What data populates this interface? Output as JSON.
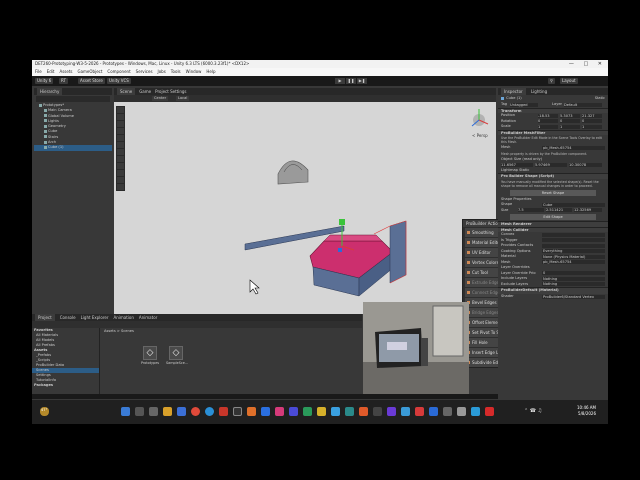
{
  "window": {
    "title": "DET260-Prototyping-W3-5-2026 - Prototypes - Windows, Mac, Linux - Unity 6.3 LTS (6000.3.23f1)* <DX12>"
  },
  "menu": [
    "File",
    "Edit",
    "Assets",
    "GameObject",
    "Component",
    "Services",
    "Jobs",
    "Tools",
    "Window",
    "Help"
  ],
  "toolbar": {
    "unity": "Unity 6",
    "account": "RT",
    "asset_store": "Asset Store",
    "vcs": "Unity VCS",
    "layout": "Layout"
  },
  "hierarchy": {
    "tab": "Hierarchy",
    "items": [
      {
        "label": "Prototypes*",
        "indent": 1,
        "selected": false
      },
      {
        "label": "Main Camera",
        "indent": 2,
        "selected": false
      },
      {
        "label": "Global Volume",
        "indent": 2,
        "selected": false
      },
      {
        "label": "Lights",
        "indent": 2,
        "selected": false
      },
      {
        "label": "Geometry",
        "indent": 2,
        "selected": false
      },
      {
        "label": "Cube",
        "indent": 2,
        "selected": false
      },
      {
        "label": "Stairs",
        "indent": 2,
        "selected": false
      },
      {
        "label": "Arch",
        "indent": 2,
        "selected": false
      },
      {
        "label": "Cube (1)",
        "indent": 2,
        "selected": true
      }
    ]
  },
  "scene_tabs": [
    "Scene",
    "Game",
    "Project Settings"
  ],
  "scene_tools": {
    "pivot": "Center",
    "space": "Local",
    "persp": "< Persp"
  },
  "probuilder": {
    "title": "ProBuilder Actions",
    "actions": [
      {
        "label": "Smoothing",
        "disabled": false
      },
      {
        "label": "Material Editor",
        "disabled": false
      },
      {
        "label": "UV Editor",
        "disabled": false
      },
      {
        "label": "Vertex Colors",
        "disabled": false
      },
      {
        "label": "Cut Tool",
        "disabled": false
      },
      {
        "label": "Extrude Edges",
        "disabled": true
      },
      {
        "label": "Connect Edges",
        "disabled": true
      },
      {
        "label": "Bevel Edges",
        "disabled": false
      },
      {
        "label": "Bridge Edges",
        "disabled": true
      },
      {
        "label": "Offset Elements",
        "disabled": false
      },
      {
        "label": "Set Pivot To Selection",
        "disabled": false
      },
      {
        "label": "Fill Hole",
        "disabled": false
      },
      {
        "label": "Insert Edge Loop",
        "disabled": false
      },
      {
        "label": "Subdivide Edges",
        "disabled": false
      }
    ]
  },
  "inspector": {
    "tabs": [
      "Inspector",
      "Lighting"
    ],
    "object_name": "Cube (1)",
    "static": "Static",
    "tag_label": "Tag",
    "tag": "Untagged",
    "layer_label": "Layer",
    "layer": "Default",
    "transform": {
      "title": "Transform",
      "position": {
        "x": "-18.53",
        "y": "5.3073",
        "z": "21.327"
      },
      "rotation": {
        "x": "0",
        "y": "0",
        "z": "0"
      },
      "scale": {
        "x": "1",
        "y": "1",
        "z": "1"
      },
      "labels": [
        "Position",
        "Rotation",
        "Scale"
      ]
    },
    "meshfilter": {
      "title": "ProBuilder MeshFilter",
      "note": "Use the ProBuilder Edit Mode in the Scene Tools Overlay to edit this Mesh.",
      "mesh_label": "Mesh",
      "mesh": "pb_Mesh-65754",
      "note2": "Mesh property is driven by the ProBuilder component.",
      "size_label": "Object Size (read only)",
      "size": {
        "x": "11.6567",
        "y": "5.97469",
        "z": "10.30078"
      },
      "lightmap": "Lightmap Static"
    },
    "pbshape": {
      "title": "Pro Builder Shape (Script)",
      "note": "You have manually modified the selected shape(s). Reset the shape to remove all manual changes in order to proceed.",
      "reset_btn": "Reset Shape",
      "props_label": "Shape Properties",
      "shape_label": "Shape",
      "shape": "Cube",
      "size_label": "Size",
      "size": {
        "x": "7.5",
        "y": "2.511421",
        "z": "12.32569"
      },
      "edit_btn": "Edit Shape"
    },
    "renderer": {
      "title": "Mesh Renderer"
    },
    "collider": {
      "title": "Mesh Collider",
      "rows": [
        {
          "label": "Convex",
          "value": ""
        },
        {
          "label": "Is Trigger",
          "value": ""
        },
        {
          "label": "Provides Contacts",
          "value": ""
        },
        {
          "label": "Cooking Options",
          "value": "Everything"
        },
        {
          "label": "Material",
          "value": "None (Physics Material)"
        },
        {
          "label": "Mesh",
          "value": "pb_Mesh-65754"
        }
      ],
      "layer_overrides": "Layer Overrides",
      "layer_rows": [
        {
          "label": "Layer Override Prio",
          "value": "0"
        },
        {
          "label": "Include Layers",
          "value": "Nothing"
        },
        {
          "label": "Exclude Layers",
          "value": "Nothing"
        }
      ]
    },
    "material": {
      "name": "ProBuilderDefault (Material)",
      "shader_label": "Shader",
      "shader": "ProBuilder6/Standard Vertex"
    }
  },
  "project": {
    "tabs": [
      "Project",
      "Console",
      "Light Explorer",
      "Animation",
      "Animator"
    ],
    "favorites": "Favorites",
    "fav_items": [
      "All Materials",
      "All Models",
      "All Prefabs"
    ],
    "assets": "Assets",
    "asset_items": [
      "_Prefabs",
      "_Scripts",
      "ProBuilder Data",
      "Scenes",
      "Settings",
      "TutorialInfo"
    ],
    "packages": "Packages",
    "breadcrumb": "Assets > Scenes",
    "files": [
      "Prototypes",
      "SampleSce..."
    ]
  },
  "taskbar": {
    "time": "10:46 AM",
    "date": "5/8/2026",
    "temp": "47°"
  },
  "colors": {
    "selection": "#2c5d87",
    "pb_face": "#cc2f6e",
    "grid_cube": "#5a6f95"
  }
}
